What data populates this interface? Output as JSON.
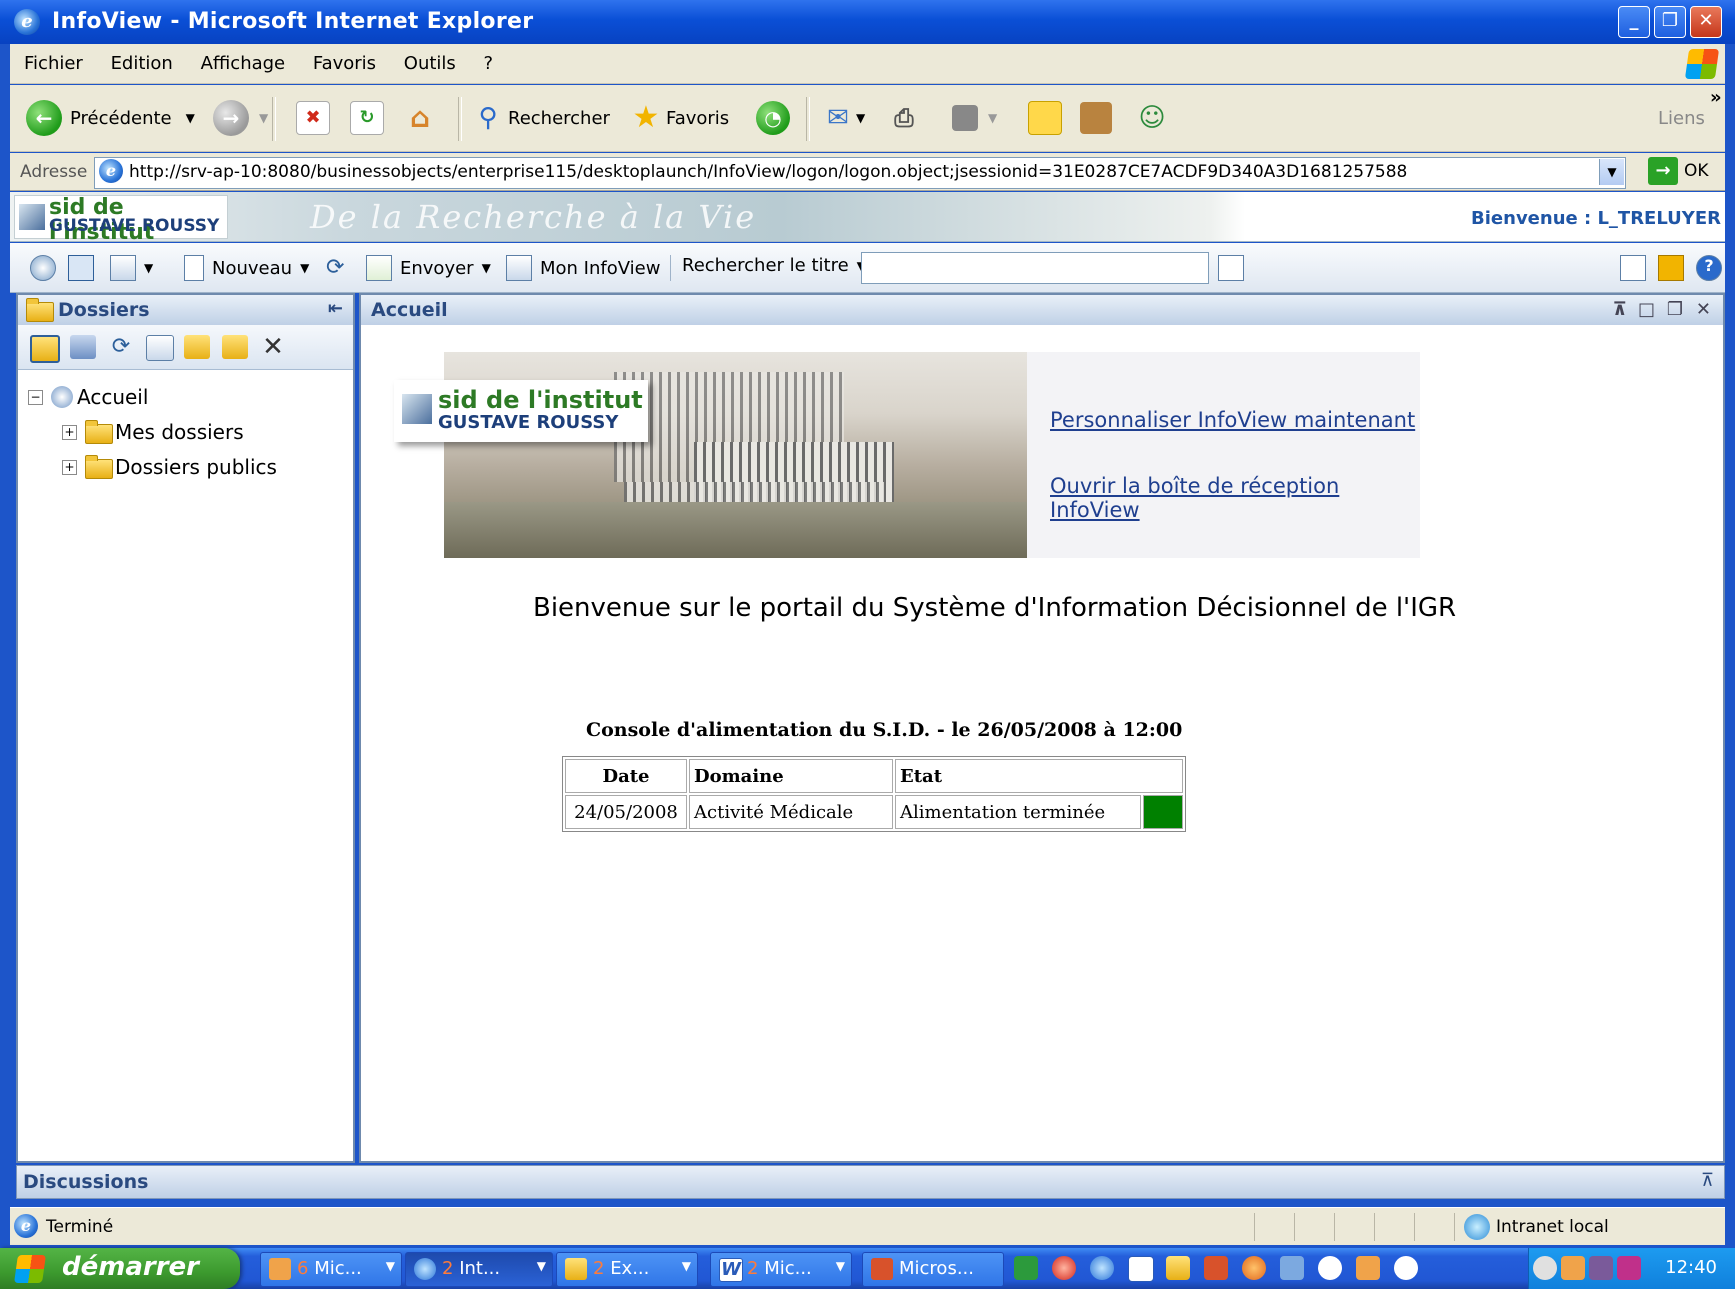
{
  "window": {
    "title": "InfoView - Microsoft Internet Explorer",
    "minimize_label": "_",
    "restore_label": "❐",
    "close_label": "✕"
  },
  "menu": [
    "Fichier",
    "Edition",
    "Affichage",
    "Favoris",
    "Outils",
    "?"
  ],
  "toolbar": {
    "back_label": "Précédente",
    "search_label": "Rechercher",
    "favorites_label": "Favoris",
    "links_label": "Liens"
  },
  "address": {
    "label": "Adresse",
    "url": "http://srv-ap-10:8080/businessobjects/enterprise115/desktoplaunch/InfoView/logon/logon.object;jsessionid=31E0287CE7ACDF9D340A3D1681257588",
    "go_label": "OK"
  },
  "header": {
    "logo_line1": "sid de l'institut",
    "logo_line2": "GUSTAVE ROUSSY",
    "motto": "De la Recherche à la Vie",
    "welcome": "Bienvenue : L_TRELUYER"
  },
  "infoview_toolbar": {
    "new_label": "Nouveau",
    "send_label": "Envoyer",
    "my_infoview_label": "Mon InfoView",
    "search_title_label": "Rechercher le titre",
    "search_value": ""
  },
  "left_panel": {
    "title": "Dossiers",
    "tree": {
      "root": "Accueil",
      "children": [
        "Mes dossiers",
        "Dossiers publics"
      ]
    }
  },
  "main_panel": {
    "title": "Accueil",
    "links": [
      "Personnaliser InfoView maintenant",
      "Ouvrir la boîte de réception InfoView"
    ],
    "welcome_text": "Bienvenue sur le portail du Système d'Information Décisionnel de l'IGR",
    "console_title": "Console d'alimentation du S.I.D. - le 26/05/2008 à 12:00",
    "console_table": {
      "headers": [
        "Date",
        "Domaine",
        "Etat"
      ],
      "rows": [
        {
          "date": "24/05/2008",
          "domaine": "Activité Médicale",
          "etat": "Alimentation terminée",
          "status_color": "#008000"
        }
      ]
    }
  },
  "discussions": {
    "title": "Discussions"
  },
  "status": {
    "text": "Terminé",
    "zone": "Intranet local"
  },
  "taskbar": {
    "start_label": "démarrer",
    "buttons": [
      {
        "count": "6",
        "label": "Mic..."
      },
      {
        "count": "2",
        "label": "Int..."
      },
      {
        "count": "2",
        "label": "Ex..."
      },
      {
        "count": "2",
        "label": "Mic..."
      },
      {
        "count": "",
        "label": "Micros..."
      }
    ],
    "clock": "12:40"
  }
}
